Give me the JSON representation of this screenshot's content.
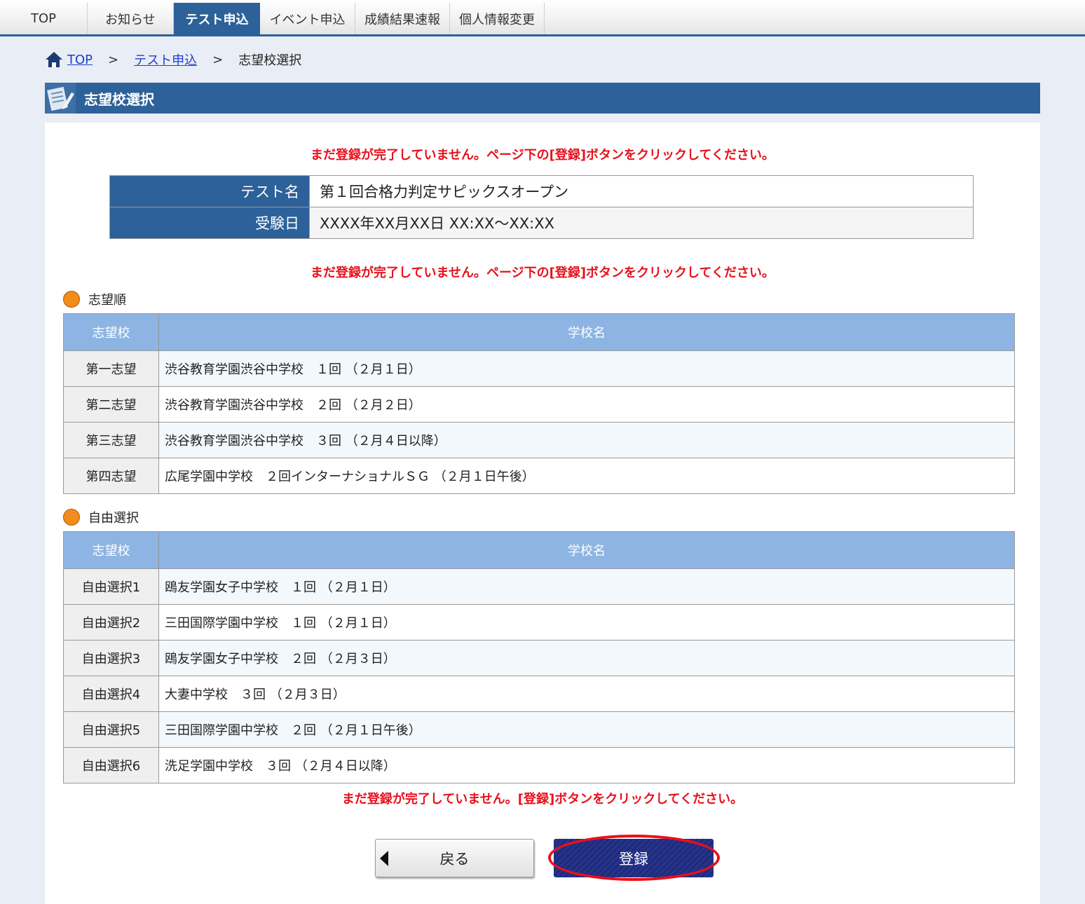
{
  "nav": {
    "items": [
      {
        "label": "TOP",
        "active": false
      },
      {
        "label": "お知らせ",
        "active": false
      },
      {
        "label": "テスト申込",
        "active": true
      },
      {
        "label": "イベント申込",
        "active": false
      },
      {
        "label": "成績結果速報",
        "active": false
      },
      {
        "label": "個人情報変更",
        "active": false
      }
    ]
  },
  "breadcrumb": {
    "home": "TOP",
    "level1": "テスト申込",
    "current": "志望校選択",
    "separator": ">"
  },
  "page_title": "志望校選択",
  "warnings": {
    "top": "まだ登録が完了していません。ページ下の[登録]ボタンをクリックしてください。",
    "middle": "まだ登録が完了していません。ページ下の[登録]ボタンをクリックしてください。",
    "bottom": "まだ登録が完了していません。[登録]ボタンをクリックしてください。"
  },
  "info": {
    "test_name_label": "テスト名",
    "test_name": "第１回合格力判定サピックスオープン",
    "date_label": "受験日",
    "date": "XXXX年XX月XX日 XX:XX～XX:XX"
  },
  "preference": {
    "section_label": "志望順",
    "col1": "志望校",
    "col2": "学校名",
    "rows": [
      {
        "rank": "第一志望",
        "school": "渋谷教育学園渋谷中学校　１回 （２月１日）"
      },
      {
        "rank": "第二志望",
        "school": "渋谷教育学園渋谷中学校　２回 （２月２日）"
      },
      {
        "rank": "第三志望",
        "school": "渋谷教育学園渋谷中学校　３回 （２月４日以降）"
      },
      {
        "rank": "第四志望",
        "school": "広尾学園中学校　２回インターナショナルＳＧ （２月１日午後）"
      }
    ]
  },
  "free": {
    "section_label": "自由選択",
    "col1": "志望校",
    "col2": "学校名",
    "rows": [
      {
        "rank": "自由選択1",
        "school": "鴎友学園女子中学校　１回 （２月１日）"
      },
      {
        "rank": "自由選択2",
        "school": "三田国際学園中学校　１回 （２月１日）"
      },
      {
        "rank": "自由選択3",
        "school": "鴎友学園女子中学校　２回 （２月３日）"
      },
      {
        "rank": "自由選択4",
        "school": "大妻中学校　３回 （２月３日）"
      },
      {
        "rank": "自由選択5",
        "school": "三田国際学園中学校　２回 （２月１日午後）"
      },
      {
        "rank": "自由選択6",
        "school": "洗足学園中学校　３回 （２月４日以降）"
      }
    ]
  },
  "buttons": {
    "back": "戻る",
    "register": "登録"
  },
  "colors": {
    "primary": "#2d6199",
    "table_header": "#8db4e2",
    "warning": "#e8101c",
    "section_dot": "#f28c1c",
    "register_button": "#1f2b7a",
    "highlight_ring": "#e8101c"
  }
}
